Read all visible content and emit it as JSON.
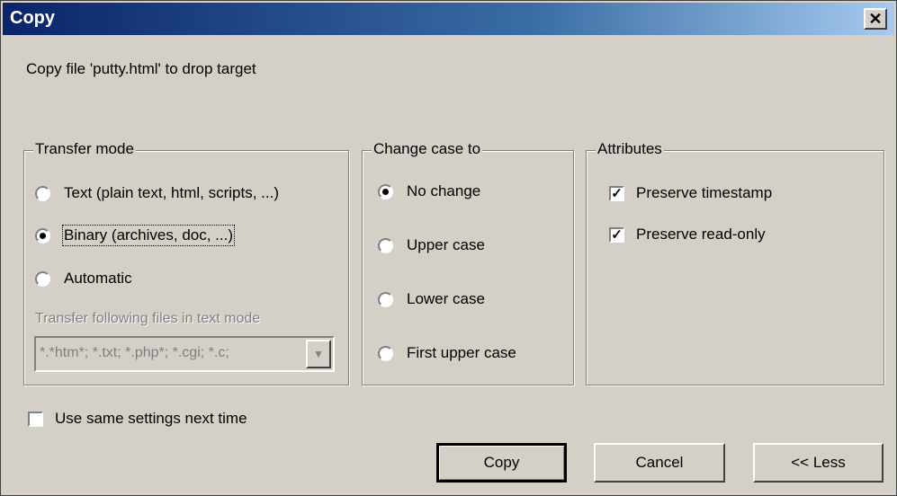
{
  "window": {
    "title": "Copy",
    "close_glyph": "✕"
  },
  "message": "Copy file 'putty.html' to drop target",
  "transfer_mode": {
    "legend": "Transfer mode",
    "options": [
      {
        "label": "Text (plain text, html, scripts, ...)",
        "selected": false
      },
      {
        "label": "Binary (archives, doc, ...)",
        "selected": true
      },
      {
        "label": "Automatic",
        "selected": false
      }
    ],
    "text_mode_label": "Transfer following files in text mode",
    "text_mode_value": "*.*htm*; *.txt; *.php*; *.cgi; *.c;"
  },
  "change_case": {
    "legend": "Change case to",
    "options": [
      {
        "label": "No change",
        "selected": true
      },
      {
        "label": "Upper case",
        "selected": false
      },
      {
        "label": "Lower case",
        "selected": false
      },
      {
        "label": "First upper case",
        "selected": false
      }
    ]
  },
  "attributes": {
    "legend": "Attributes",
    "options": [
      {
        "label": "Preserve timestamp",
        "checked": true
      },
      {
        "label": "Preserve read-only",
        "checked": true
      }
    ]
  },
  "same_settings": {
    "label": "Use same settings next time",
    "checked": false
  },
  "buttons": {
    "copy": "Copy",
    "cancel": "Cancel",
    "less": "<< Less"
  },
  "icons": {
    "close": "close-icon",
    "check": "checkmark-icon",
    "dropdown": "chevron-down-icon"
  }
}
